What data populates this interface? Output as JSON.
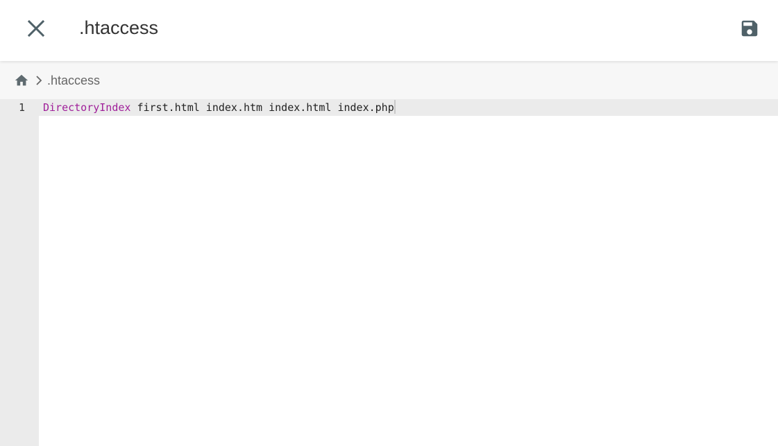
{
  "header": {
    "title": ".htaccess",
    "close_icon": "close-icon",
    "save_icon": "save-icon"
  },
  "breadcrumb": {
    "home_icon": "home-icon",
    "separator_icon": "chevron-right-icon",
    "items": [
      ".htaccess"
    ]
  },
  "editor": {
    "lines": [
      {
        "number": "1",
        "keyword": "DirectoryIndex",
        "rest": " first.html index.htm index.html index.php"
      }
    ],
    "keyword_color": "#a0209a"
  },
  "colors": {
    "icon": "#4f6168",
    "gutter": "#ebebeb",
    "breadcrumb_bg": "#f7f7f7"
  }
}
